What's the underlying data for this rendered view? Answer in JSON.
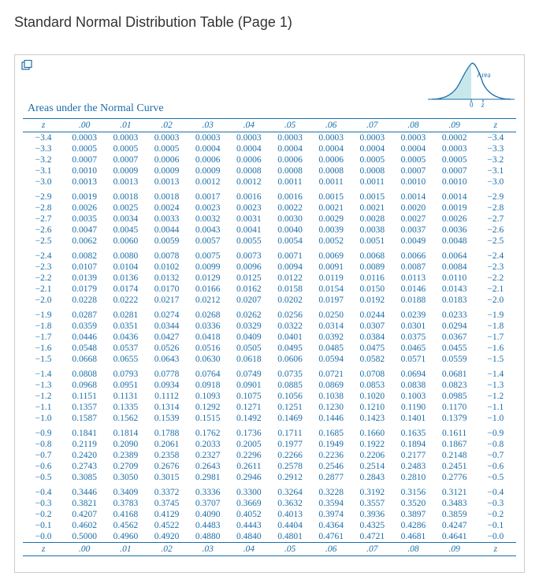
{
  "title": "Standard Normal Distribution Table (Page 1)",
  "caption": "Areas under the Normal Curve",
  "z_label": "z",
  "chart_label": "Area",
  "chart_axis_0": "0",
  "chart_axis_z": "z",
  "col_headers": [
    ".00",
    ".01",
    ".02",
    ".03",
    ".04",
    ".05",
    ".06",
    ".07",
    ".08",
    ".09"
  ],
  "rows": [
    {
      "z": "−3.4",
      "v": [
        "0.0003",
        "0.0003",
        "0.0003",
        "0.0003",
        "0.0003",
        "0.0003",
        "0.0003",
        "0.0003",
        "0.0003",
        "0.0002"
      ]
    },
    {
      "z": "−3.3",
      "v": [
        "0.0005",
        "0.0005",
        "0.0005",
        "0.0004",
        "0.0004",
        "0.0004",
        "0.0004",
        "0.0004",
        "0.0004",
        "0.0003"
      ]
    },
    {
      "z": "−3.2",
      "v": [
        "0.0007",
        "0.0007",
        "0.0006",
        "0.0006",
        "0.0006",
        "0.0006",
        "0.0006",
        "0.0005",
        "0.0005",
        "0.0005"
      ]
    },
    {
      "z": "−3.1",
      "v": [
        "0.0010",
        "0.0009",
        "0.0009",
        "0.0009",
        "0.0008",
        "0.0008",
        "0.0008",
        "0.0008",
        "0.0007",
        "0.0007"
      ]
    },
    {
      "z": "−3.0",
      "v": [
        "0.0013",
        "0.0013",
        "0.0013",
        "0.0012",
        "0.0012",
        "0.0011",
        "0.0011",
        "0.0011",
        "0.0010",
        "0.0010"
      ],
      "group_end": true
    },
    {
      "z": "−2.9",
      "v": [
        "0.0019",
        "0.0018",
        "0.0018",
        "0.0017",
        "0.0016",
        "0.0016",
        "0.0015",
        "0.0015",
        "0.0014",
        "0.0014"
      ]
    },
    {
      "z": "−2.8",
      "v": [
        "0.0026",
        "0.0025",
        "0.0024",
        "0.0023",
        "0.0023",
        "0.0022",
        "0.0021",
        "0.0021",
        "0.0020",
        "0.0019"
      ]
    },
    {
      "z": "−2.7",
      "v": [
        "0.0035",
        "0.0034",
        "0.0033",
        "0.0032",
        "0.0031",
        "0.0030",
        "0.0029",
        "0.0028",
        "0.0027",
        "0.0026"
      ]
    },
    {
      "z": "−2.6",
      "v": [
        "0.0047",
        "0.0045",
        "0.0044",
        "0.0043",
        "0.0041",
        "0.0040",
        "0.0039",
        "0.0038",
        "0.0037",
        "0.0036"
      ]
    },
    {
      "z": "−2.5",
      "v": [
        "0.0062",
        "0.0060",
        "0.0059",
        "0.0057",
        "0.0055",
        "0.0054",
        "0.0052",
        "0.0051",
        "0.0049",
        "0.0048"
      ],
      "group_end": true
    },
    {
      "z": "−2.4",
      "v": [
        "0.0082",
        "0.0080",
        "0.0078",
        "0.0075",
        "0.0073",
        "0.0071",
        "0.0069",
        "0.0068",
        "0.0066",
        "0.0064"
      ]
    },
    {
      "z": "−2.3",
      "v": [
        "0.0107",
        "0.0104",
        "0.0102",
        "0.0099",
        "0.0096",
        "0.0094",
        "0.0091",
        "0.0089",
        "0.0087",
        "0.0084"
      ]
    },
    {
      "z": "−2.2",
      "v": [
        "0.0139",
        "0.0136",
        "0.0132",
        "0.0129",
        "0.0125",
        "0.0122",
        "0.0119",
        "0.0116",
        "0.0113",
        "0.0110"
      ]
    },
    {
      "z": "−2.1",
      "v": [
        "0.0179",
        "0.0174",
        "0.0170",
        "0.0166",
        "0.0162",
        "0.0158",
        "0.0154",
        "0.0150",
        "0.0146",
        "0.0143"
      ]
    },
    {
      "z": "−2.0",
      "v": [
        "0.0228",
        "0.0222",
        "0.0217",
        "0.0212",
        "0.0207",
        "0.0202",
        "0.0197",
        "0.0192",
        "0.0188",
        "0.0183"
      ],
      "group_end": true
    },
    {
      "z": "−1.9",
      "v": [
        "0.0287",
        "0.0281",
        "0.0274",
        "0.0268",
        "0.0262",
        "0.0256",
        "0.0250",
        "0.0244",
        "0.0239",
        "0.0233"
      ]
    },
    {
      "z": "−1.8",
      "v": [
        "0.0359",
        "0.0351",
        "0.0344",
        "0.0336",
        "0.0329",
        "0.0322",
        "0.0314",
        "0.0307",
        "0.0301",
        "0.0294"
      ]
    },
    {
      "z": "−1.7",
      "v": [
        "0.0446",
        "0.0436",
        "0.0427",
        "0.0418",
        "0.0409",
        "0.0401",
        "0.0392",
        "0.0384",
        "0.0375",
        "0.0367"
      ]
    },
    {
      "z": "−1.6",
      "v": [
        "0.0548",
        "0.0537",
        "0.0526",
        "0.0516",
        "0.0505",
        "0.0495",
        "0.0485",
        "0.0475",
        "0.0465",
        "0.0455"
      ]
    },
    {
      "z": "−1.5",
      "v": [
        "0.0668",
        "0.0655",
        "0.0643",
        "0.0630",
        "0.0618",
        "0.0606",
        "0.0594",
        "0.0582",
        "0.0571",
        "0.0559"
      ],
      "group_end": true
    },
    {
      "z": "−1.4",
      "v": [
        "0.0808",
        "0.0793",
        "0.0778",
        "0.0764",
        "0.0749",
        "0.0735",
        "0.0721",
        "0.0708",
        "0.0694",
        "0.0681"
      ]
    },
    {
      "z": "−1.3",
      "v": [
        "0.0968",
        "0.0951",
        "0.0934",
        "0.0918",
        "0.0901",
        "0.0885",
        "0.0869",
        "0.0853",
        "0.0838",
        "0.0823"
      ]
    },
    {
      "z": "−1.2",
      "v": [
        "0.1151",
        "0.1131",
        "0.1112",
        "0.1093",
        "0.1075",
        "0.1056",
        "0.1038",
        "0.1020",
        "0.1003",
        "0.0985"
      ]
    },
    {
      "z": "−1.1",
      "v": [
        "0.1357",
        "0.1335",
        "0.1314",
        "0.1292",
        "0.1271",
        "0.1251",
        "0.1230",
        "0.1210",
        "0.1190",
        "0.1170"
      ]
    },
    {
      "z": "−1.0",
      "v": [
        "0.1587",
        "0.1562",
        "0.1539",
        "0.1515",
        "0.1492",
        "0.1469",
        "0.1446",
        "0.1423",
        "0.1401",
        "0.1379"
      ],
      "group_end": true
    },
    {
      "z": "−0.9",
      "v": [
        "0.1841",
        "0.1814",
        "0.1788",
        "0.1762",
        "0.1736",
        "0.1711",
        "0.1685",
        "0.1660",
        "0.1635",
        "0.1611"
      ]
    },
    {
      "z": "−0.8",
      "v": [
        "0.2119",
        "0.2090",
        "0.2061",
        "0.2033",
        "0.2005",
        "0.1977",
        "0.1949",
        "0.1922",
        "0.1894",
        "0.1867"
      ]
    },
    {
      "z": "−0.7",
      "v": [
        "0.2420",
        "0.2389",
        "0.2358",
        "0.2327",
        "0.2296",
        "0.2266",
        "0.2236",
        "0.2206",
        "0.2177",
        "0.2148"
      ]
    },
    {
      "z": "−0.6",
      "v": [
        "0.2743",
        "0.2709",
        "0.2676",
        "0.2643",
        "0.2611",
        "0.2578",
        "0.2546",
        "0.2514",
        "0.2483",
        "0.2451"
      ]
    },
    {
      "z": "−0.5",
      "v": [
        "0.3085",
        "0.3050",
        "0.3015",
        "0.2981",
        "0.2946",
        "0.2912",
        "0.2877",
        "0.2843",
        "0.2810",
        "0.2776"
      ],
      "group_end": true
    },
    {
      "z": "−0.4",
      "v": [
        "0.3446",
        "0.3409",
        "0.3372",
        "0.3336",
        "0.3300",
        "0.3264",
        "0.3228",
        "0.3192",
        "0.3156",
        "0.3121"
      ]
    },
    {
      "z": "−0.3",
      "v": [
        "0.3821",
        "0.3783",
        "0.3745",
        "0.3707",
        "0.3669",
        "0.3632",
        "0.3594",
        "0.3557",
        "0.3520",
        "0.3483"
      ]
    },
    {
      "z": "−0.2",
      "v": [
        "0.4207",
        "0.4168",
        "0.4129",
        "0.4090",
        "0.4052",
        "0.4013",
        "0.3974",
        "0.3936",
        "0.3897",
        "0.3859"
      ]
    },
    {
      "z": "−0.1",
      "v": [
        "0.4602",
        "0.4562",
        "0.4522",
        "0.4483",
        "0.4443",
        "0.4404",
        "0.4364",
        "0.4325",
        "0.4286",
        "0.4247"
      ]
    },
    {
      "z": "−0.0",
      "v": [
        "0.5000",
        "0.4960",
        "0.4920",
        "0.4880",
        "0.4840",
        "0.4801",
        "0.4761",
        "0.4721",
        "0.4681",
        "0.4641"
      ]
    }
  ],
  "chart_data": {
    "type": "area",
    "description": "Standard normal density curve with left-tail area shaded up to z",
    "labels": {
      "area": "Area",
      "axis_0": "0",
      "axis_z": "z"
    },
    "table_meaning": "Each cell gives P(Z ≤ z) for z = row + column hundredth",
    "z_range": [
      -3.4,
      0.0
    ],
    "col_offsets": [
      0.0,
      0.01,
      0.02,
      0.03,
      0.04,
      0.05,
      0.06,
      0.07,
      0.08,
      0.09
    ]
  }
}
